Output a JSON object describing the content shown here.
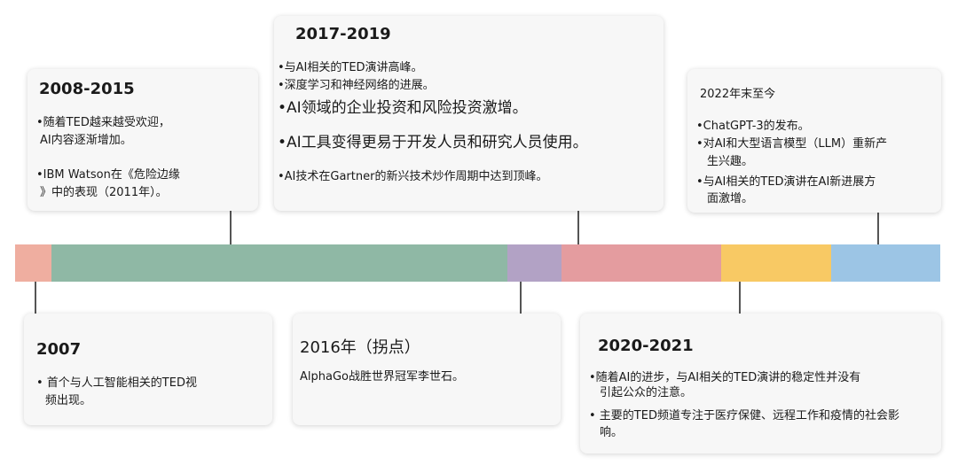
{
  "colors": {
    "seg_2007": "#efaea0",
    "seg_2008_2015": "#8fb8a5",
    "seg_2016": "#b2a2c5",
    "seg_2017_2019": "#e49c9f",
    "seg_2020_2021": "#f8c964",
    "seg_2022": "#9cc5e5",
    "card_bg": "#f7f7f7",
    "connector": "#555555"
  },
  "cards": {
    "c2008": {
      "title": "2008-2015",
      "lines": [
        "•随着TED越来越受欢迎，",
        "AI内容逐渐增加。",
        "•IBM Watson在《危险边缘",
        "》中的表现（2011年）。"
      ]
    },
    "c2017": {
      "title": "2017-2019",
      "lines": [
        "•与AI相关的TED演讲高峰。",
        "•深度学习和神经网络的进展。",
        "•AI领域的企业投资和风险投资激增。",
        "•AI工具变得更易于开发人员和研究人员使用。",
        "•AI技术在Gartner的新兴技术炒作周期中达到顶峰。"
      ]
    },
    "c2022": {
      "title": "2022年末至今",
      "lines": [
        "•ChatGPT-3的发布。",
        "•对AI和大型语言模型（LLM）重新产",
        "生兴趣。",
        "•与AI相关的TED演讲在AI新进展方",
        "面激增。"
      ]
    },
    "c2007": {
      "title": "2007",
      "lines": [
        "• 首个与人工智能相关的TED视",
        "频出现。"
      ]
    },
    "c2016": {
      "title": "2016年（拐点）",
      "lines": [
        "AlphaGo战胜世界冠军李世石。"
      ]
    },
    "c2020": {
      "title": "2020-2021",
      "lines": [
        "•随着AI的进步，与AI相关的TED演讲的稳定性并没有",
        "引起公众的注意。",
        "• 主要的TED频道专注于医疗保健、远程工作和疫情的社会影",
        "响。"
      ]
    }
  }
}
